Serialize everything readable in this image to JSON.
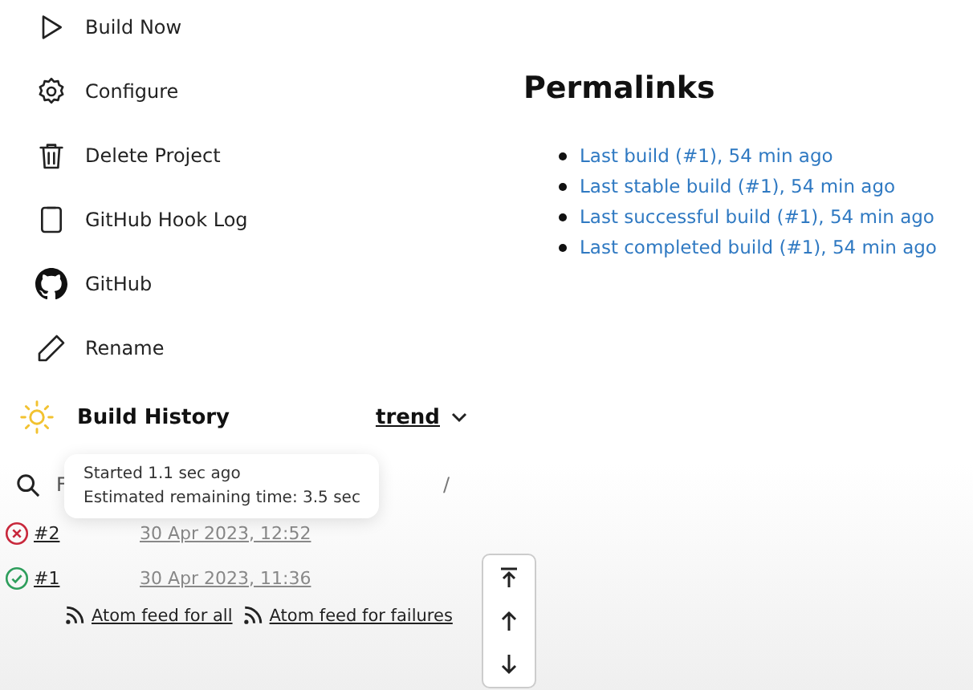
{
  "sidebar": {
    "items": [
      {
        "kind": "build",
        "label": "Build Now"
      },
      {
        "kind": "configure",
        "label": "Configure"
      },
      {
        "kind": "delete",
        "label": "Delete Project"
      },
      {
        "kind": "log",
        "label": "GitHub Hook Log"
      },
      {
        "kind": "github",
        "label": "GitHub"
      },
      {
        "kind": "rename",
        "label": "Rename"
      }
    ]
  },
  "permalinks": {
    "title": "Permalinks",
    "links": [
      "Last build (#1), 54 min ago",
      "Last stable build (#1), 54 min ago",
      "Last successful build (#1), 54 min ago",
      "Last completed build (#1), 54 min ago"
    ]
  },
  "build_history": {
    "title": "Build History",
    "trend": "trend",
    "search": {
      "placeholder": "F",
      "shortcut": "/"
    },
    "tooltip": [
      "Started 1.1 sec ago",
      "Estimated remaining time: 3.5 sec"
    ],
    "builds": [
      {
        "kind": "failed",
        "number": "#2",
        "time": "30 Apr 2023, 12:52"
      },
      {
        "kind": "success",
        "number": "#1",
        "time": "30 Apr 2023, 11:36"
      }
    ],
    "feeds": [
      "Atom feed for all",
      "Atom feed for failures"
    ]
  }
}
